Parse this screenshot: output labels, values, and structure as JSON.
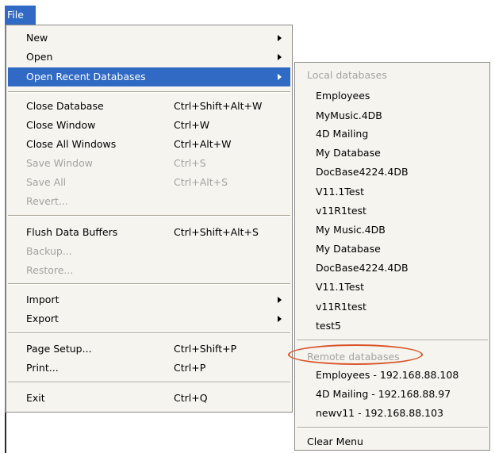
{
  "menubar": {
    "file_label": "File"
  },
  "file_menu": {
    "items": [
      {
        "label": "New",
        "shortcut": "",
        "has_submenu": true,
        "disabled": false
      },
      {
        "label": "Open",
        "shortcut": "",
        "has_submenu": true,
        "disabled": false
      },
      {
        "label": "Open Recent Databases",
        "shortcut": "",
        "has_submenu": true,
        "disabled": false,
        "highlighted": true
      },
      {
        "label": "Close Database",
        "shortcut": "Ctrl+Shift+Alt+W",
        "disabled": false
      },
      {
        "label": "Close Window",
        "shortcut": "Ctrl+W",
        "disabled": false
      },
      {
        "label": "Close All Windows",
        "shortcut": "Ctrl+Alt+W",
        "disabled": false
      },
      {
        "label": "Save Window",
        "shortcut": "Ctrl+S",
        "disabled": true
      },
      {
        "label": "Save All",
        "shortcut": "Ctrl+Alt+S",
        "disabled": true
      },
      {
        "label": "Revert...",
        "shortcut": "",
        "disabled": true
      },
      {
        "label": "Flush Data Buffers",
        "shortcut": "Ctrl+Shift+Alt+S",
        "disabled": false
      },
      {
        "label": "Backup...",
        "shortcut": "",
        "disabled": true
      },
      {
        "label": "Restore...",
        "shortcut": "",
        "disabled": true
      },
      {
        "label": "Import",
        "shortcut": "",
        "has_submenu": true,
        "disabled": false
      },
      {
        "label": "Export",
        "shortcut": "",
        "has_submenu": true,
        "disabled": false
      },
      {
        "label": "Page Setup...",
        "shortcut": "Ctrl+Shift+P",
        "disabled": false
      },
      {
        "label": "Print...",
        "shortcut": "Ctrl+P",
        "disabled": false
      },
      {
        "label": "Exit",
        "shortcut": "Ctrl+Q",
        "disabled": false
      }
    ]
  },
  "recent_submenu": {
    "local_header": "Local databases",
    "local_items": [
      "Employees",
      "MyMusic.4DB",
      "4D Mailing",
      "My Database",
      "DocBase4224.4DB",
      "V11.1Test",
      "v11R1test",
      "My Music.4DB",
      "My Database",
      "DocBase4224.4DB",
      "V11.1Test",
      "v11R1test",
      "test5"
    ],
    "remote_header": "Remote databases",
    "remote_items": [
      "Employees - 192.168.88.108",
      "4D Mailing - 192.168.88.97",
      "newv11 - 192.168.88.103"
    ],
    "clear_label": "Clear Menu"
  },
  "colors": {
    "highlight": "#316ac5",
    "annotation_oval": "#d9542a",
    "disabled_text": "#a5a3a0"
  }
}
